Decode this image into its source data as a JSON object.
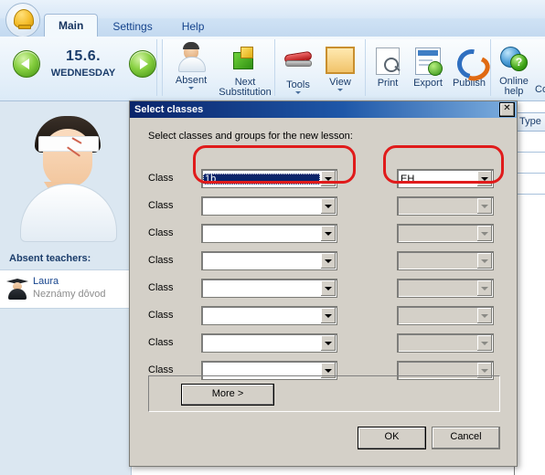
{
  "app": {
    "tabs": [
      {
        "label": "Main",
        "active": true
      },
      {
        "label": "Settings",
        "active": false
      },
      {
        "label": "Help",
        "active": false
      }
    ],
    "logo_icon": "bell-icon",
    "navigation": {
      "prev_icon": "arrow-left-icon",
      "next_icon": "arrow-right-icon",
      "date": "15.6.",
      "weekday": "WEDNESDAY"
    },
    "ribbon_groups": [
      {
        "buttons": [
          {
            "label": "Absent",
            "label2": "",
            "icon": "person-icon",
            "dropdown": true
          },
          {
            "label": "Next",
            "label2": "Substitution",
            "icon": "green-cube-icon",
            "dropdown": false
          }
        ]
      },
      {
        "buttons": [
          {
            "label": "Tools",
            "label2": "",
            "icon": "stapler-icon",
            "dropdown": true
          },
          {
            "label": "View",
            "label2": "",
            "icon": "board-icon",
            "dropdown": true
          }
        ]
      },
      {
        "buttons": [
          {
            "label": "Print",
            "label2": "",
            "icon": "print-preview-icon",
            "dropdown": false
          },
          {
            "label": "Export",
            "label2": "",
            "icon": "export-icon",
            "dropdown": false
          },
          {
            "label": "Publish",
            "label2": "",
            "icon": "publish-icon",
            "dropdown": false
          }
        ]
      },
      {
        "buttons": [
          {
            "label": "Online",
            "label2": "help",
            "icon": "globe-help-icon",
            "dropdown": false
          },
          {
            "label": "Co",
            "label2": "",
            "icon": "",
            "dropdown": false
          }
        ]
      }
    ]
  },
  "sidebar": {
    "illustration_icon": "injured-teacher-illustration",
    "section_title": "Absent teachers:",
    "teachers": [
      {
        "name": "Laura",
        "reason": "Neznámy dôvod",
        "icon": "graduate-icon"
      }
    ]
  },
  "table": {
    "columns": [
      "Type"
    ],
    "row_count": 3
  },
  "dialog": {
    "title": "Select classes",
    "close_icon": "close-icon",
    "intro": "Select classes and groups for the new lesson:",
    "row_label": "Class",
    "rows": [
      {
        "class_value": "1b",
        "class_selected": true,
        "class_disabled": false,
        "group_value": "EH",
        "group_disabled": false
      },
      {
        "class_value": "",
        "class_selected": false,
        "class_disabled": false,
        "group_value": "",
        "group_disabled": true
      },
      {
        "class_value": "",
        "class_selected": false,
        "class_disabled": false,
        "group_value": "",
        "group_disabled": true
      },
      {
        "class_value": "",
        "class_selected": false,
        "class_disabled": false,
        "group_value": "",
        "group_disabled": true
      },
      {
        "class_value": "",
        "class_selected": false,
        "class_disabled": false,
        "group_value": "",
        "group_disabled": true
      },
      {
        "class_value": "",
        "class_selected": false,
        "class_disabled": false,
        "group_value": "",
        "group_disabled": true
      },
      {
        "class_value": "",
        "class_selected": false,
        "class_disabled": false,
        "group_value": "",
        "group_disabled": true
      },
      {
        "class_value": "",
        "class_selected": false,
        "class_disabled": false,
        "group_value": "",
        "group_disabled": true
      }
    ],
    "more_label": "More >",
    "ok_label": "OK",
    "cancel_label": "Cancel"
  },
  "annotations": {
    "color": "#e01b1b",
    "shapes": [
      {
        "name": "highlight-class-combo",
        "target": "row 1 class combo"
      },
      {
        "name": "highlight-group-combo",
        "target": "row 1 group combo"
      }
    ]
  }
}
